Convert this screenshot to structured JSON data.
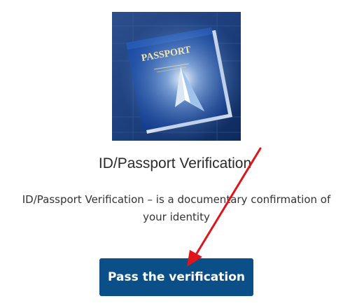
{
  "verification_card": {
    "image_icon": "passport-book-with-paper-plane",
    "passport_cover_text": "PASSPORT",
    "title": "ID/Passport Verification",
    "description": "ID/Passport Verification – is a documentary confirmation of your identity",
    "button_label": "Pass the verification"
  },
  "annotation": {
    "arrow_color": "#e0141b"
  },
  "colors": {
    "button_background": "#0b4f88",
    "button_text": "#ffffff",
    "title_text": "#2a2a2a"
  }
}
